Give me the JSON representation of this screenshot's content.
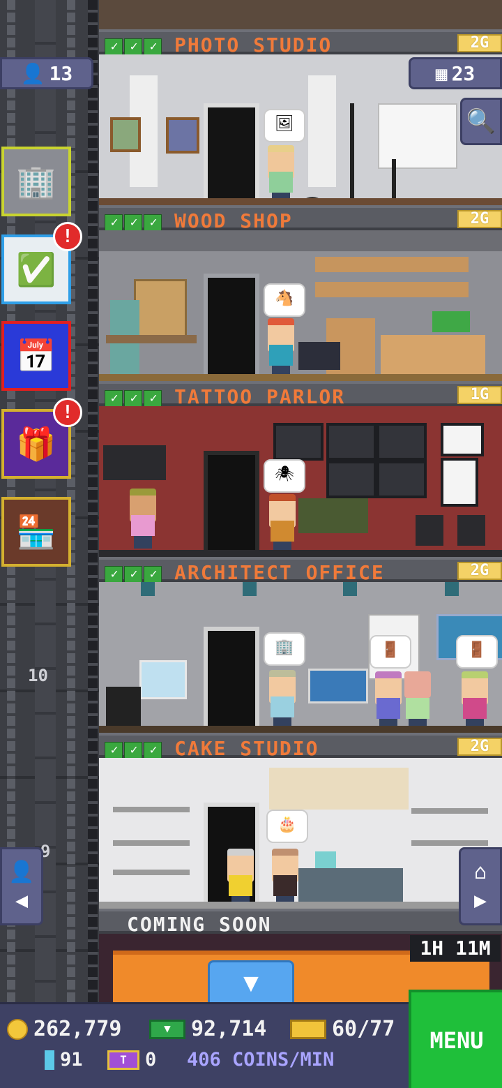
{
  "floors": [
    {
      "name": "PHOTO STUDIO",
      "badge": "2G",
      "bubble": "🖼"
    },
    {
      "name": "WOOD SHOP",
      "badge": "2G",
      "bubble": "🐴"
    },
    {
      "name": "TATTOO PARLOR",
      "badge": "1G",
      "bubble": "🕷"
    },
    {
      "name": "ARCHITECT OFFICE",
      "badge": "2G",
      "bubble": "🏢"
    },
    {
      "name": "CAKE STUDIO",
      "badge": "2G",
      "bubble": "🎂"
    }
  ],
  "coming_soon": {
    "label": "COMING SOON",
    "timer": "1H 11M"
  },
  "hud": {
    "population": "13",
    "floor_count": "23",
    "floor_marker": "10",
    "floor_marker_partial": "9"
  },
  "stats": {
    "coins": "262,779",
    "bux": "92,714",
    "golden_tickets": "60/77",
    "legendary": "91",
    "vip": "0",
    "rate": "406 COINS/MIN"
  },
  "alerts": {
    "missions": "!",
    "gift": "!"
  },
  "menu_label": "MENU",
  "colors": {
    "accent": "#f07a3a",
    "menu": "#1fbf3a",
    "bar": "#3e4164"
  }
}
